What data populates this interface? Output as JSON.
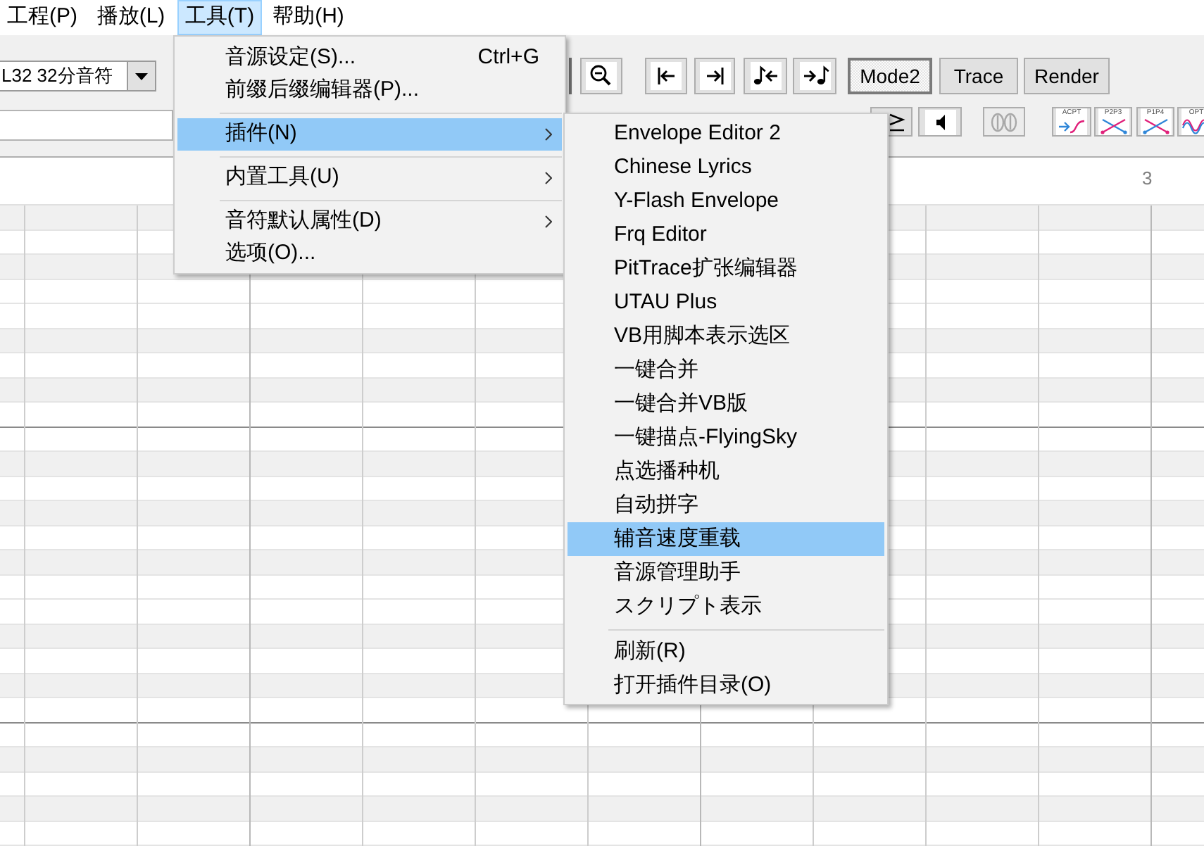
{
  "menu_bar": [
    {
      "label": "工程(P)",
      "selected": false
    },
    {
      "label": "播放(L)",
      "selected": false
    },
    {
      "label": "工具(T)",
      "selected": true
    },
    {
      "label": "帮助(H)",
      "selected": false
    }
  ],
  "toolbar": {
    "note_length": "L32 32分音符",
    "mode_buttons": [
      {
        "label": "Mode2",
        "selected": true
      },
      {
        "label": "Trace",
        "selected": false
      },
      {
        "label": "Render",
        "selected": false
      }
    ],
    "tool_buttons": [
      {
        "disabled": false
      },
      {
        "disabled": false
      },
      {
        "disabled": true
      }
    ],
    "envelope_buttons": [
      {
        "label": "ACPT"
      },
      {
        "label": "P2P3"
      },
      {
        "label": "P1P4"
      },
      {
        "label": "OPT"
      }
    ]
  },
  "ruler": {
    "measure_number": "3"
  },
  "piano_roll": {
    "rows": [
      {
        "kind": "black",
        "octave_line": false
      },
      {
        "kind": "white",
        "octave_line": false
      },
      {
        "kind": "black",
        "octave_line": false
      },
      {
        "kind": "white",
        "octave_line": false
      },
      {
        "kind": "white",
        "octave_line": false
      },
      {
        "kind": "black",
        "octave_line": false
      },
      {
        "kind": "white",
        "octave_line": false
      },
      {
        "kind": "black",
        "octave_line": false
      },
      {
        "kind": "white",
        "octave_line": true
      },
      {
        "kind": "white",
        "octave_line": false
      },
      {
        "kind": "black",
        "octave_line": false
      },
      {
        "kind": "white",
        "octave_line": false
      },
      {
        "kind": "black",
        "octave_line": false
      },
      {
        "kind": "white",
        "octave_line": false
      },
      {
        "kind": "black",
        "octave_line": false
      },
      {
        "kind": "white",
        "octave_line": false
      },
      {
        "kind": "white",
        "octave_line": false
      },
      {
        "kind": "black",
        "octave_line": false
      },
      {
        "kind": "white",
        "octave_line": false
      },
      {
        "kind": "black",
        "octave_line": false
      },
      {
        "kind": "white",
        "octave_line": true
      },
      {
        "kind": "white",
        "octave_line": false
      },
      {
        "kind": "black",
        "octave_line": false
      },
      {
        "kind": "white",
        "octave_line": false
      },
      {
        "kind": "black",
        "octave_line": false
      },
      {
        "kind": "white",
        "octave_line": false
      }
    ]
  },
  "tools_menu": {
    "items": [
      {
        "kind": "item",
        "label": "音源设定(S)...",
        "shortcut": "Ctrl+G",
        "selected": false
      },
      {
        "kind": "item",
        "label": "前缀后缀编辑器(P)...",
        "selected": false
      },
      {
        "kind": "separator"
      },
      {
        "kind": "submenu",
        "label": "插件(N)",
        "selected": true
      },
      {
        "kind": "separator"
      },
      {
        "kind": "submenu",
        "label": "内置工具(U)",
        "selected": false
      },
      {
        "kind": "separator"
      },
      {
        "kind": "submenu",
        "label": "音符默认属性(D)",
        "selected": false
      },
      {
        "kind": "item",
        "label": "选项(O)...",
        "selected": false
      }
    ]
  },
  "plugins_menu": {
    "items": [
      {
        "kind": "item",
        "label": "Envelope Editor 2",
        "selected": false
      },
      {
        "kind": "item",
        "label": "Chinese Lyrics",
        "selected": false
      },
      {
        "kind": "item",
        "label": "Y-Flash Envelope",
        "selected": false
      },
      {
        "kind": "item",
        "label": "Frq Editor",
        "selected": false
      },
      {
        "kind": "item",
        "label": "PitTrace扩张编辑器",
        "selected": false
      },
      {
        "kind": "item",
        "label": "UTAU Plus",
        "selected": false
      },
      {
        "kind": "item",
        "label": "VB用脚本表示选区",
        "selected": false
      },
      {
        "kind": "item",
        "label": "一键合并",
        "selected": false
      },
      {
        "kind": "item",
        "label": "一键合并VB版",
        "selected": false
      },
      {
        "kind": "item",
        "label": "一键描点-FlyingSky",
        "selected": false
      },
      {
        "kind": "item",
        "label": "点选播种机",
        "selected": false
      },
      {
        "kind": "item",
        "label": "自动拼字",
        "selected": false
      },
      {
        "kind": "item",
        "label": "辅音速度重载",
        "selected": true
      },
      {
        "kind": "item",
        "label": "音源管理助手",
        "selected": false
      },
      {
        "kind": "item",
        "label": "スクリプト表示",
        "selected": false
      },
      {
        "kind": "separator"
      },
      {
        "kind": "item",
        "label": "刷新(R)",
        "selected": false
      },
      {
        "kind": "item",
        "label": "打开插件目录(O)",
        "selected": false
      }
    ]
  }
}
